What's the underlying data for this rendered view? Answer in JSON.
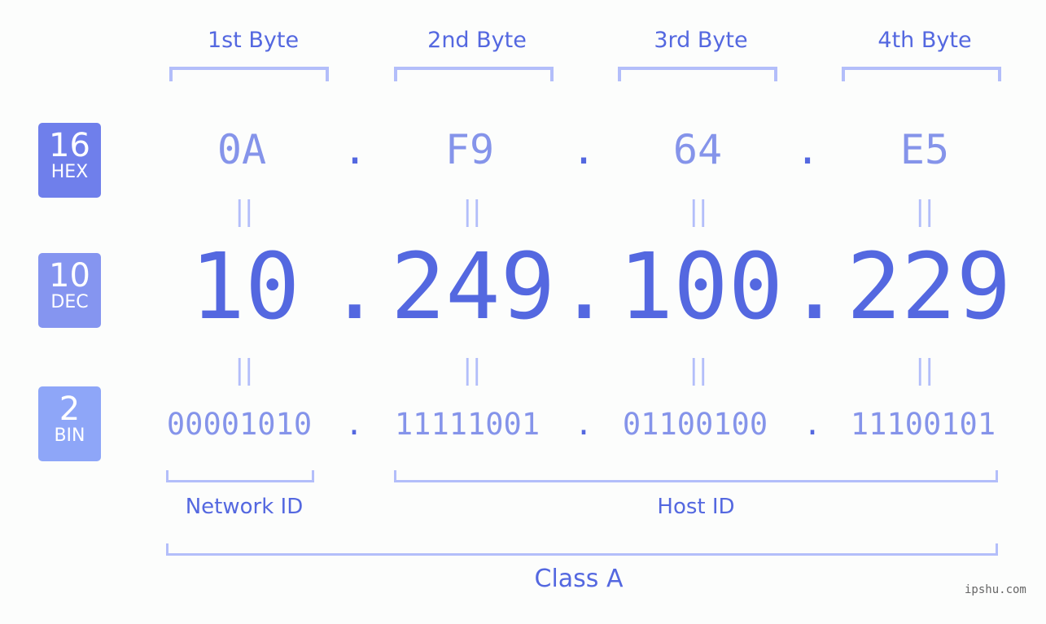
{
  "bytes": [
    {
      "label": "1st Byte",
      "hex": "0A",
      "dec": "10",
      "bin": "00001010"
    },
    {
      "label": "2nd Byte",
      "hex": "F9",
      "dec": "249",
      "bin": "11111001"
    },
    {
      "label": "3rd Byte",
      "hex": "64",
      "dec": "100",
      "bin": "01100100"
    },
    {
      "label": "4th Byte",
      "hex": "E5",
      "dec": "229",
      "bin": "11100101"
    }
  ],
  "separator": ".",
  "equals": "||",
  "badges": {
    "hex": {
      "num": "16",
      "label": "HEX",
      "color": "#6f7feb"
    },
    "dec": {
      "num": "10",
      "label": "DEC",
      "color": "#8595f0"
    },
    "bin": {
      "num": "2",
      "label": "BIN",
      "color": "#8ea6f8"
    }
  },
  "segments": {
    "network": "Network ID",
    "host": "Host ID",
    "class": "Class A"
  },
  "watermark": "ipshu.com"
}
